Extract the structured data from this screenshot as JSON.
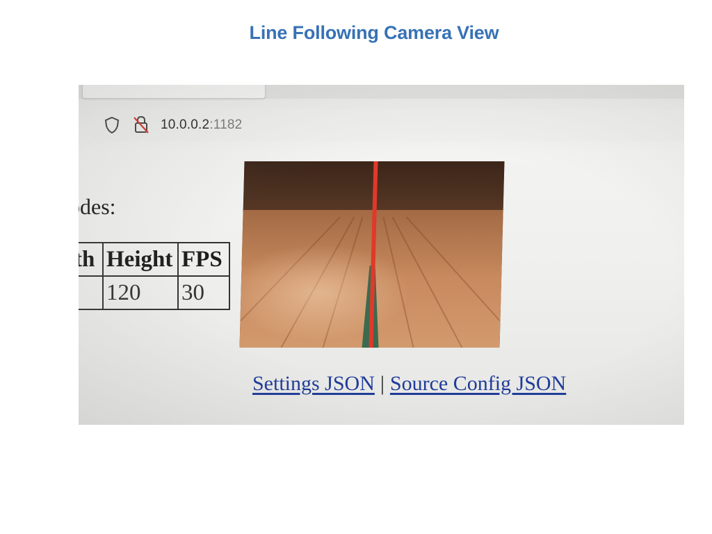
{
  "slide": {
    "title": "Line Following Camera View"
  },
  "browser": {
    "address": {
      "host": "10.0.0.2",
      "port": ":1182"
    }
  },
  "page": {
    "modes_label": "odes:",
    "table": {
      "headers": [
        "th",
        "Height",
        "FPS"
      ],
      "rows": [
        [
          "",
          "120",
          "30"
        ]
      ]
    },
    "camera": {
      "overlay_line_color": "#e0392b"
    },
    "links": {
      "settings": "Settings JSON",
      "separator": "|",
      "source_config": "Source Config JSON"
    }
  }
}
